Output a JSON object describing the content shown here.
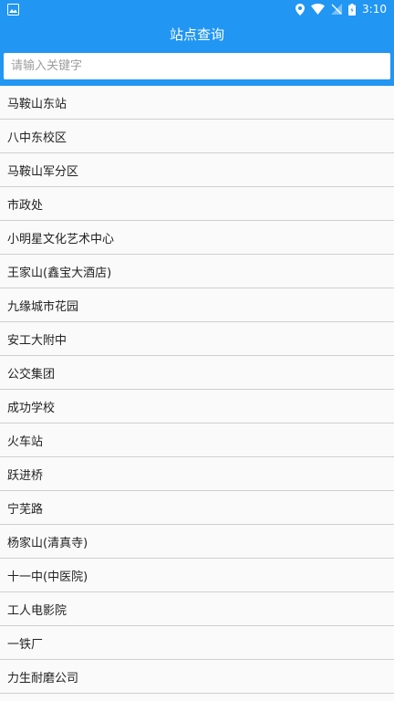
{
  "status_bar": {
    "time": "3:10",
    "icons": [
      "image-icon",
      "location-icon",
      "wifi-icon",
      "signal-off-icon",
      "battery-icon"
    ]
  },
  "app_bar": {
    "title": "站点查询"
  },
  "search": {
    "placeholder": "请输入关键字",
    "value": ""
  },
  "stations": [
    "马鞍山东站",
    "八中东校区",
    "马鞍山军分区",
    "市政处",
    "小明星文化艺术中心",
    "王家山(鑫宝大酒店)",
    "九缘城市花园",
    "安工大附中",
    "公交集团",
    "成功学校",
    "火车站",
    "跃进桥",
    "宁芜路",
    "杨家山(清真寺)",
    "十一中(中医院)",
    "工人电影院",
    "一铁厂",
    "力生耐磨公司"
  ],
  "colors": {
    "primary": "#2196f3",
    "background": "#fafafa",
    "divider": "#cfcfcf"
  }
}
